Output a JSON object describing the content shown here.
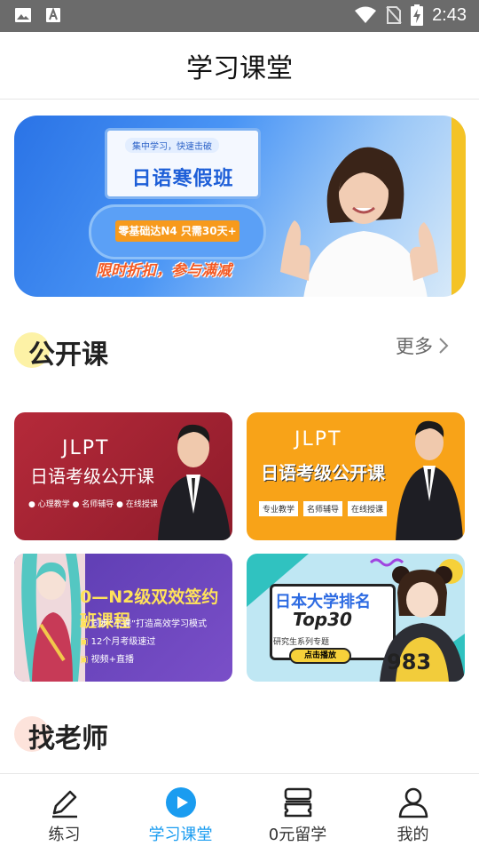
{
  "status_bar": {
    "time": "2:43"
  },
  "header": {
    "title": "学习课堂"
  },
  "banner": {
    "tagline": "集中学习，快速击破",
    "title": "日语寒假班",
    "offer": "零基础达N4  只需30天+",
    "promo": "限时折扣，参与满减"
  },
  "public_courses": {
    "title": "公开课",
    "more_label": "更多",
    "tiles": [
      {
        "heading": "JLPT",
        "title": "日语考级公开课",
        "tags": "● 心理教学  ● 名师辅导  ● 在线授课"
      },
      {
        "heading": "JLPT",
        "title": "日语考级公开课",
        "tags": [
          "专业教学",
          "名师辅导",
          "在线授课"
        ]
      },
      {
        "title": "0—N2级双效签约班课程",
        "bullets": [
          "同步“三课”打造高效学习模式",
          "12个月考级速过",
          "视频+直播"
        ]
      },
      {
        "title": "日本大学排名",
        "subtitle": "Top30",
        "caption": "研究生系列专题",
        "button": "点击播放",
        "jersey": "983"
      }
    ]
  },
  "find_teacher": {
    "title": "找老师"
  },
  "bottom_nav": {
    "items": [
      {
        "label": "练习",
        "icon": "pen-icon"
      },
      {
        "label": "学习课堂",
        "icon": "play-circle-icon"
      },
      {
        "label": "0元留学",
        "icon": "ticket-stack-icon"
      },
      {
        "label": "我的",
        "icon": "person-icon"
      }
    ],
    "active_index": 1,
    "active_color": "#1a9cf0"
  }
}
